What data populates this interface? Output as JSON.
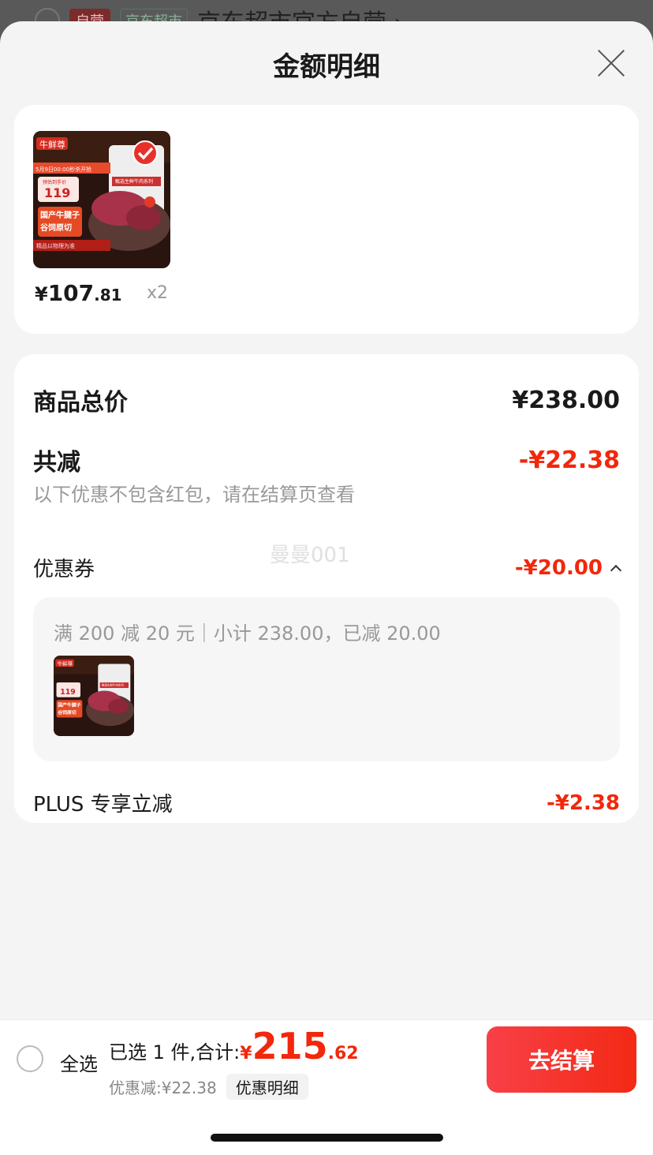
{
  "background": {
    "tag_self": "自营",
    "tag_store": "京东超市",
    "store_name": "京东超市官方自营 ›"
  },
  "sheet": {
    "title": "金额明细"
  },
  "product": {
    "price_currency": "¥",
    "price_integer": "107",
    "price_decimal": ".81",
    "quantity": "x2",
    "image": {
      "brand": "牛鲜尊",
      "promo": "5月9日00:00秒杀开抢",
      "price_label": "预估到手价",
      "price": "119",
      "line1": "国产牛腱子",
      "line2": "谷饲原切",
      "pack_title": "甄选生鲜牛肉系列",
      "footer": "精品以物理为准"
    }
  },
  "detail": {
    "total_label": "商品总价",
    "total_value": "¥238.00",
    "reduce_label": "共减",
    "reduce_value": "-¥22.38",
    "reduce_note": "以下优惠不包含红包，请在结算页查看",
    "coupon_label": "优惠券",
    "coupon_value": "-¥20.00",
    "coupon_rule": "满 200 减 20 元｜小计 238.00，已减 20.00",
    "plus_label": "PLUS 专享立减",
    "plus_value": "-¥2.38",
    "watermark": "曼曼001"
  },
  "bottom_bar": {
    "select_all": "全选",
    "summary_prefix": "已选 1 件,合计:",
    "total_currency": "¥",
    "total_integer": "215",
    "total_decimal": ".62",
    "discount_text": "优惠减:¥22.38",
    "discount_detail": "优惠明细",
    "checkout": "去结算"
  },
  "colors": {
    "accent_red": "#f2270c",
    "checkout_gradient_start": "#f84048",
    "checkout_gradient_end": "#f32914"
  }
}
